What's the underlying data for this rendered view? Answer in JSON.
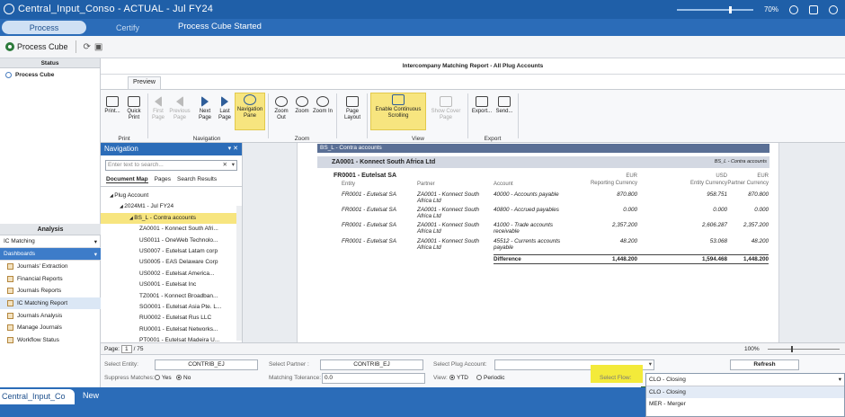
{
  "title_bar": {
    "title": "Central_Input_Conso  -  ACTUAL  -  Jul FY24",
    "zoom": "70%"
  },
  "process_bar": {
    "tabs": [
      "Process",
      "Certify"
    ],
    "status": "Process Cube Started"
  },
  "toolbar": {
    "process_cube_label": "Process Cube"
  },
  "left_panel": {
    "status_header": "Status",
    "process_cube_item": "Process Cube",
    "analysis_header": "Analysis",
    "ic_matching": "IC Matching",
    "dashboards": "Dashboards",
    "dashboard_items": [
      "Journals' Extraction",
      "Financial Reports",
      "Journals Reports",
      "IC Matching Report",
      "Journals Analysis",
      "Manage Journals",
      "Workflow Status"
    ]
  },
  "report": {
    "title": "Intercompany Matching Report - All Plug Accounts",
    "ribbon_tab": "Preview",
    "ribbon": {
      "print": {
        "label": "Print",
        "buttons": [
          "Print...",
          "Quick Print"
        ]
      },
      "navigation": {
        "label": "Navigation",
        "buttons": [
          "First Page",
          "Previous Page",
          "Next Page",
          "Last Page",
          "Navigation Pane"
        ]
      },
      "zoom": {
        "label": "Zoom",
        "buttons": [
          "Zoom Out",
          "Zoom",
          "Zoom In"
        ]
      },
      "page_layout": "Page Layout",
      "view": {
        "label": "View",
        "buttons": [
          "Enable Continuous Scrolling",
          "Show Cover Page"
        ]
      },
      "export": {
        "label": "Export",
        "buttons": [
          "Export...",
          "Send..."
        ]
      }
    }
  },
  "navigation_pane": {
    "header": "Navigation",
    "search_placeholder": "Enter text to search...",
    "tabs": [
      "Document Map",
      "Pages",
      "Search Results"
    ],
    "tree": [
      {
        "indent": 0,
        "label": "Plug Account"
      },
      {
        "indent": 1,
        "label": "2024M1 - Jul FY24"
      },
      {
        "indent": 2,
        "label": "BS_L - Contra accounts",
        "selected": true
      },
      {
        "indent": 3,
        "label": "ZA0001 - Konnect South Afri..."
      },
      {
        "indent": 3,
        "label": "US0011 - OneWeb Technolo..."
      },
      {
        "indent": 3,
        "label": "US0007 - Eutelsat Latam corp"
      },
      {
        "indent": 3,
        "label": "US0005 - EAS Delaware Corp"
      },
      {
        "indent": 3,
        "label": "US0002 - Eutelsat America..."
      },
      {
        "indent": 3,
        "label": "US0001 - Eutelsat Inc"
      },
      {
        "indent": 3,
        "label": "TZ0001 - Konnect Broadban..."
      },
      {
        "indent": 3,
        "label": "SG0001 - Eutelsat Asia Pte. L..."
      },
      {
        "indent": 3,
        "label": "RU0002 - Eutelsat Rus LLC"
      },
      {
        "indent": 3,
        "label": "RU0001 - Eutelsat Networks..."
      },
      {
        "indent": 3,
        "label": "PT0001 - Eutelsat Madeira U..."
      }
    ]
  },
  "document": {
    "section": "BS_L - Contra accounts",
    "partner_heading": "ZA0001 - Konnect South Africa Ltd",
    "partner_tag": "BS_L - Contra accounts",
    "entity_heading": "FR0001 - Eutelsat SA",
    "columns": {
      "entity": "Entity",
      "partner": "Partner",
      "account": "Account",
      "rep_ccy_code": "EUR",
      "rep_ccy": "Reporting Currency",
      "ent_ccy_code": "USD",
      "ent_ccy": "Entity Currency",
      "par_ccy_code": "EUR",
      "par_ccy": "Partner Currency"
    },
    "rows": [
      {
        "entity": "FR0001 - Eutelsat SA",
        "partner": "ZA0001 - Konnect South Africa Ltd",
        "account": "40000 - Accounts payable",
        "reporting": "870.800",
        "entity_ccy": "958.751",
        "partner_ccy": "870.800"
      },
      {
        "entity": "FR0001 - Eutelsat SA",
        "partner": "ZA0001 - Konnect South Africa Ltd",
        "account": "40800 - Accrued payables",
        "reporting": "0.000",
        "entity_ccy": "0.000",
        "partner_ccy": "0.000"
      },
      {
        "entity": "FR0001 - Eutelsat SA",
        "partner": "ZA0001 - Konnect South Africa Ltd",
        "account": "41000 - Trade accounts receivable",
        "reporting": "2,357.200",
        "entity_ccy": "2,606.287",
        "partner_ccy": "2,357.200"
      },
      {
        "entity": "FR0001 - Eutelsat SA",
        "partner": "ZA0001 - Konnect South Africa Ltd",
        "account": "45512 - Currents accounts payable",
        "reporting": "48.200",
        "entity_ccy": "53.068",
        "partner_ccy": "48.200"
      }
    ],
    "difference": {
      "label": "Difference",
      "reporting": "1,448.200",
      "entity_ccy": "1,594.468",
      "partner_ccy": "1,448.200"
    }
  },
  "status_strip": {
    "page_label": "Page:",
    "page_value": "1",
    "page_total": "/ 75",
    "zoom": "100%"
  },
  "filters": {
    "entity_label": "Select Entity:",
    "entity_value": "CONTRIB_EJ",
    "partner_label": "Select Partner :",
    "partner_value": "CONTRIB_EJ",
    "plug_label": "Select Plug Account:",
    "plug_value": "",
    "refresh": "Refresh",
    "suppress_label": "Suppress Matches:",
    "suppress_yes": "Yes",
    "suppress_no": "No",
    "tolerance_label": "Matching Tolerance:",
    "tolerance_value": "0.0",
    "view_label": "View:",
    "view_ytd": "YTD",
    "view_periodic": "Periodic",
    "flow_label": "Select Flow:"
  },
  "flow_dropdown": {
    "current": "CLO - Closing",
    "options": [
      "CLO - Closing",
      "MER - Merger"
    ]
  },
  "bottom_bar": {
    "workspace_tab": "Central_Input_Co",
    "new_label": "New"
  },
  "colors": {
    "brand_blue": "#1f5fa8",
    "highlight_yellow": "#f7e57f",
    "section_bar": "#5a6f95"
  }
}
